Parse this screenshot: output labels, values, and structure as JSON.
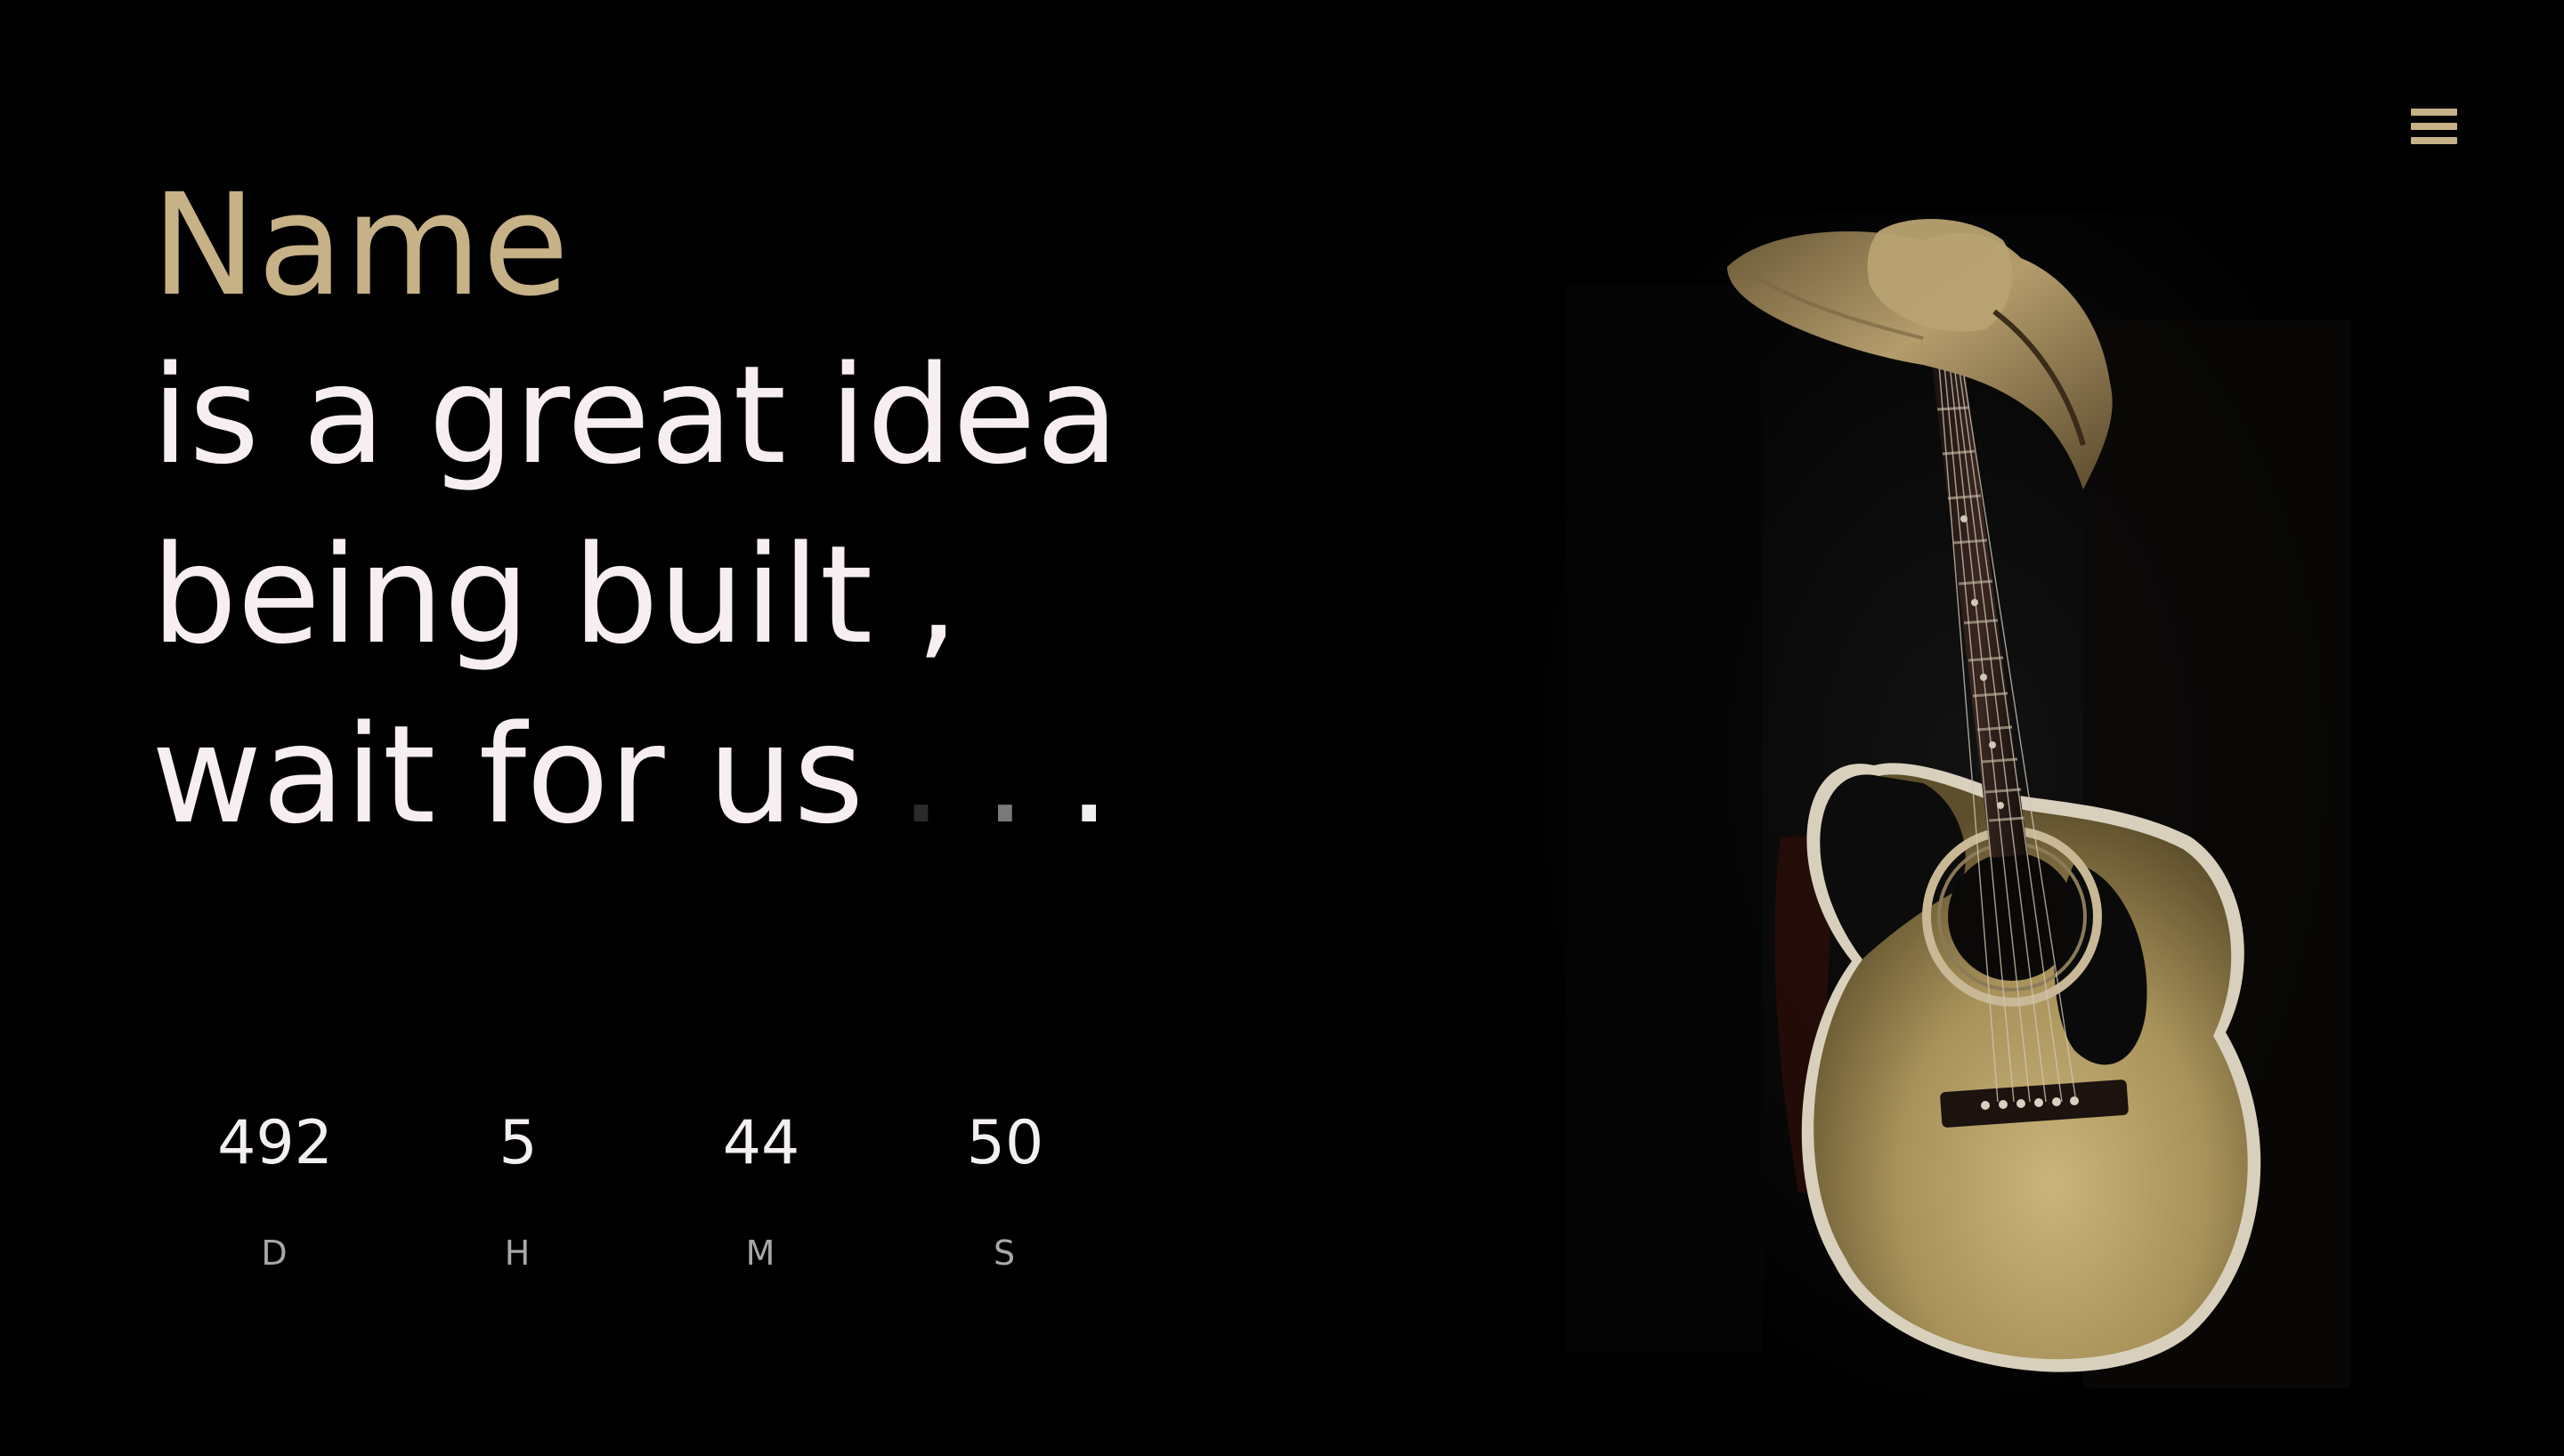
{
  "page": {
    "background": "#000000",
    "accent": "#c7b187",
    "text": "#f6eef1"
  },
  "menu": {
    "icon": "hamburger-menu-icon"
  },
  "headline": {
    "brand": "Name",
    "lines": [
      "is a great idea",
      "being built ,",
      "wait for us"
    ],
    "dots": [
      ".",
      ".",
      "."
    ]
  },
  "countdown": {
    "units": [
      {
        "value": "492",
        "label": "D"
      },
      {
        "value": "5",
        "label": "H"
      },
      {
        "value": "44",
        "label": "M"
      },
      {
        "value": "50",
        "label": "S"
      }
    ]
  },
  "hero_image": {
    "subject": "acoustic guitar with straw cowboy hat"
  }
}
